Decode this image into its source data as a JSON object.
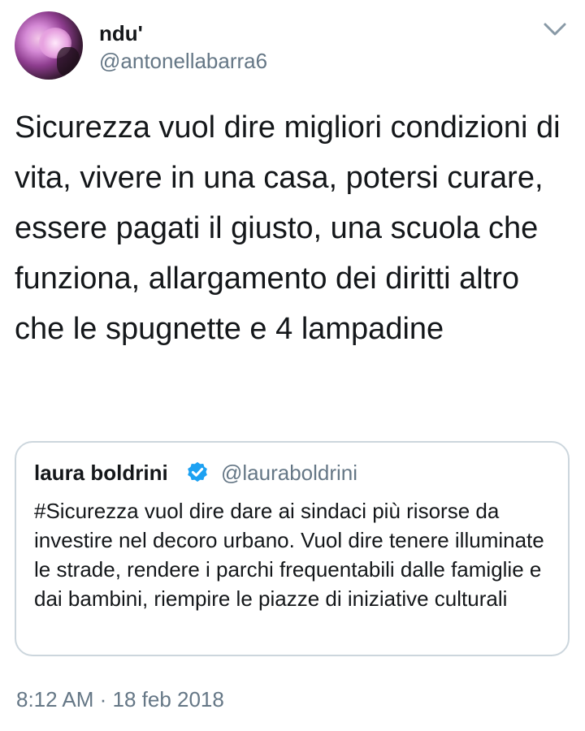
{
  "author": {
    "display_name": "ndu'",
    "handle": "@antonellabarra6"
  },
  "tweet": {
    "text": "Sicurezza vuol dire migliori condizioni di vita, vivere in una casa, potersi curare, essere pagati il giusto, una scuola che funziona, allargamento dei diritti altro che le spugnette e 4 lampadine"
  },
  "quoted_tweet": {
    "display_name": "laura boldrini",
    "handle": "@lauraboldrini",
    "text": "#Sicurezza vuol dire dare ai sindaci più risorse da investire nel decoro urbano. Vuol dire tenere illuminate le strade, rendere i parchi frequentabili dalle famiglie e dai bambini, riempire le piazze di iniziative culturali"
  },
  "timestamp": "8:12 AM · 18 feb 2018",
  "icons": {
    "menu": "chevron-down-icon",
    "verified": "verified-badge-icon"
  },
  "colors": {
    "text": "#14171a",
    "secondary": "#657786",
    "border": "#ccd6dd",
    "verified": "#1da1f2"
  }
}
